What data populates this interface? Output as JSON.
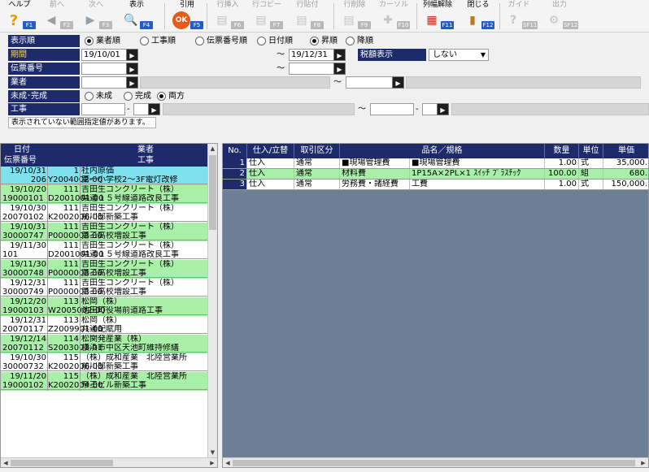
{
  "colors": {
    "header_navy": "#1e2b6a",
    "row_green": "#a8f0a8",
    "row_selected": "#7fe0ee",
    "fkey_blue": "#1f5bd6",
    "empty_area": "#6d7f94"
  },
  "toolbar": [
    {
      "label": "ヘルプ",
      "fkey": "F1",
      "icon": "help-icon",
      "glyph": "?",
      "enabled": true
    },
    {
      "label": "前へ",
      "fkey": "F2",
      "icon": "arrow-left-icon",
      "glyph": "◀",
      "enabled": false
    },
    {
      "label": "次へ",
      "fkey": "F3",
      "icon": "arrow-right-icon",
      "glyph": "▶",
      "enabled": false
    },
    {
      "label": "表示",
      "fkey": "F4",
      "icon": "magnifier-icon",
      "glyph": "🔍",
      "enabled": true
    },
    {
      "label": "引用",
      "fkey": "F5",
      "icon": "ok-icon",
      "glyph": "OK",
      "enabled": true
    },
    {
      "label": "行挿入",
      "fkey": "F6",
      "icon": "row-insert-icon",
      "glyph": "▤",
      "enabled": false
    },
    {
      "label": "行コピー",
      "fkey": "F7",
      "icon": "row-copy-icon",
      "glyph": "▤",
      "enabled": false
    },
    {
      "label": "行貼付",
      "fkey": "F8",
      "icon": "row-paste-icon",
      "glyph": "▤",
      "enabled": false
    },
    {
      "label": "行削除",
      "fkey": "F9",
      "icon": "row-delete-icon",
      "glyph": "▤",
      "enabled": false
    },
    {
      "label": "カーソル",
      "fkey": "F10",
      "icon": "cursor-icon",
      "glyph": "✚",
      "enabled": false
    },
    {
      "label": "列幅解除",
      "fkey": "F11",
      "icon": "column-width-icon",
      "glyph": "▦",
      "enabled": true
    },
    {
      "label": "閉じる",
      "fkey": "F12",
      "icon": "close-door-icon",
      "glyph": "▮",
      "enabled": true
    },
    {
      "label": "ガイド",
      "fkey": "SF11",
      "icon": "guide-icon",
      "glyph": "?",
      "enabled": false
    },
    {
      "label": "出力",
      "fkey": "SF12",
      "icon": "output-icon",
      "glyph": "⚙",
      "enabled": false
    }
  ],
  "filter": {
    "display_order_label": "表示順",
    "order_options": [
      "業者順",
      "工事順",
      "伝票番号順",
      "日付順"
    ],
    "sort_options": [
      "昇順",
      "降順"
    ],
    "period_label": "期間",
    "period_from": "19/10/01",
    "period_to": "19/12/31",
    "tilde": "～",
    "tax_label": "税額表示",
    "tax_value": "しない",
    "slip_label": "伝票番号",
    "vendor_label": "業者",
    "status_label": "未成･完成",
    "status_options": [
      "未成",
      "完成",
      "両方"
    ],
    "work_label": "工事",
    "dash": "-",
    "message": "表示されていない範囲指定値があります。"
  },
  "left_grid": {
    "headers": {
      "date": "日付",
      "slip": "伝票番号",
      "vendor": "業者",
      "work": "工事"
    },
    "records": [
      {
        "date": "19/10/31",
        "code": "1",
        "vendor": "社内原価",
        "slip": "206",
        "kcode": "Y2004002-00",
        "work": "第一小学校2～3F電灯改修",
        "color": "selected"
      },
      {
        "date": "19/10/20",
        "code": "111",
        "vendor": "吉田生コンクリート（株）",
        "slip": "19000101",
        "kcode": "D2001001-00",
        "work": "県道１５号線道路改良工事",
        "color": "green"
      },
      {
        "date": "19/10/30",
        "code": "111",
        "vendor": "吉田生コンクリート（株）",
        "slip": "20070102",
        "kcode": "K2002006-00",
        "work": "前川邸新築工事",
        "color": "white"
      },
      {
        "date": "19/10/31",
        "code": "111",
        "vendor": "吉田生コンクリート（株）",
        "slip": "30000747",
        "kcode": "P0000003-00",
        "work": "第三高校増設工事",
        "color": "green"
      },
      {
        "date": "19/11/30",
        "code": "111",
        "vendor": "吉田生コンクリート（株）",
        "slip": "101",
        "kcode": "D2001001-00",
        "work": "県道１５号線道路改良工事",
        "color": "white"
      },
      {
        "date": "19/11/30",
        "code": "111",
        "vendor": "吉田生コンクリート（株）",
        "slip": "30000748",
        "kcode": "P0000003-00",
        "work": "第三高校増設工事",
        "color": "green"
      },
      {
        "date": "19/12/31",
        "code": "111",
        "vendor": "吉田生コンクリート（株）",
        "slip": "30000749",
        "kcode": "P0000003-00",
        "work": "第三高校増設工事",
        "color": "white"
      },
      {
        "date": "19/12/20",
        "code": "113",
        "vendor": "松岡（株）",
        "slip": "19000103",
        "kcode": "W2005002-00",
        "work": "池田町役場前道路工事",
        "color": "green"
      },
      {
        "date": "19/12/31",
        "code": "113",
        "vendor": "松岡（株）",
        "slip": "20070117",
        "kcode": "Z2009901-00",
        "work": "共通配賦用",
        "color": "white"
      },
      {
        "date": "19/12/14",
        "code": "114",
        "vendor": "松関発産業（株）",
        "slip": "20070112",
        "kcode": "S2003003-01",
        "work": "横浜市中区天池町維持修繕",
        "color": "green"
      },
      {
        "date": "19/10/30",
        "code": "115",
        "vendor": "（株）成和産業　北陸営業所",
        "slip": "30000732",
        "kcode": "K2002006-00",
        "work": "前川邸新築工事",
        "color": "white"
      },
      {
        "date": "19/11/20",
        "code": "115",
        "vendor": "（株）成和産業　北陸営業所",
        "slip": "19000102",
        "kcode": "K2002004-00",
        "work": "帝王ビル新築工事",
        "color": "green"
      }
    ]
  },
  "right_grid": {
    "headers": [
      "No.",
      "仕入/立替",
      "取引区分",
      "品名／規格",
      "数量",
      "単位",
      "単価"
    ],
    "rows": [
      {
        "no": "1",
        "type": "仕入",
        "category": "通常",
        "item": "■現場管理費",
        "spec": "■現場管理費",
        "qty": "1.00",
        "unit": "式",
        "price": "35,000."
      },
      {
        "no": "2",
        "type": "仕入",
        "category": "通常",
        "item": "材料費",
        "spec": "1P15A×2PL×1 ｽｲｯﾁ ﾌﾟﾗｽﾁｯｸ",
        "qty": "100.00",
        "unit": "組",
        "price": "680."
      },
      {
        "no": "3",
        "type": "仕入",
        "category": "通常",
        "item": "労務費・諸経費",
        "spec": "工費",
        "qty": "1.00",
        "unit": "式",
        "price": "150,000."
      }
    ]
  }
}
